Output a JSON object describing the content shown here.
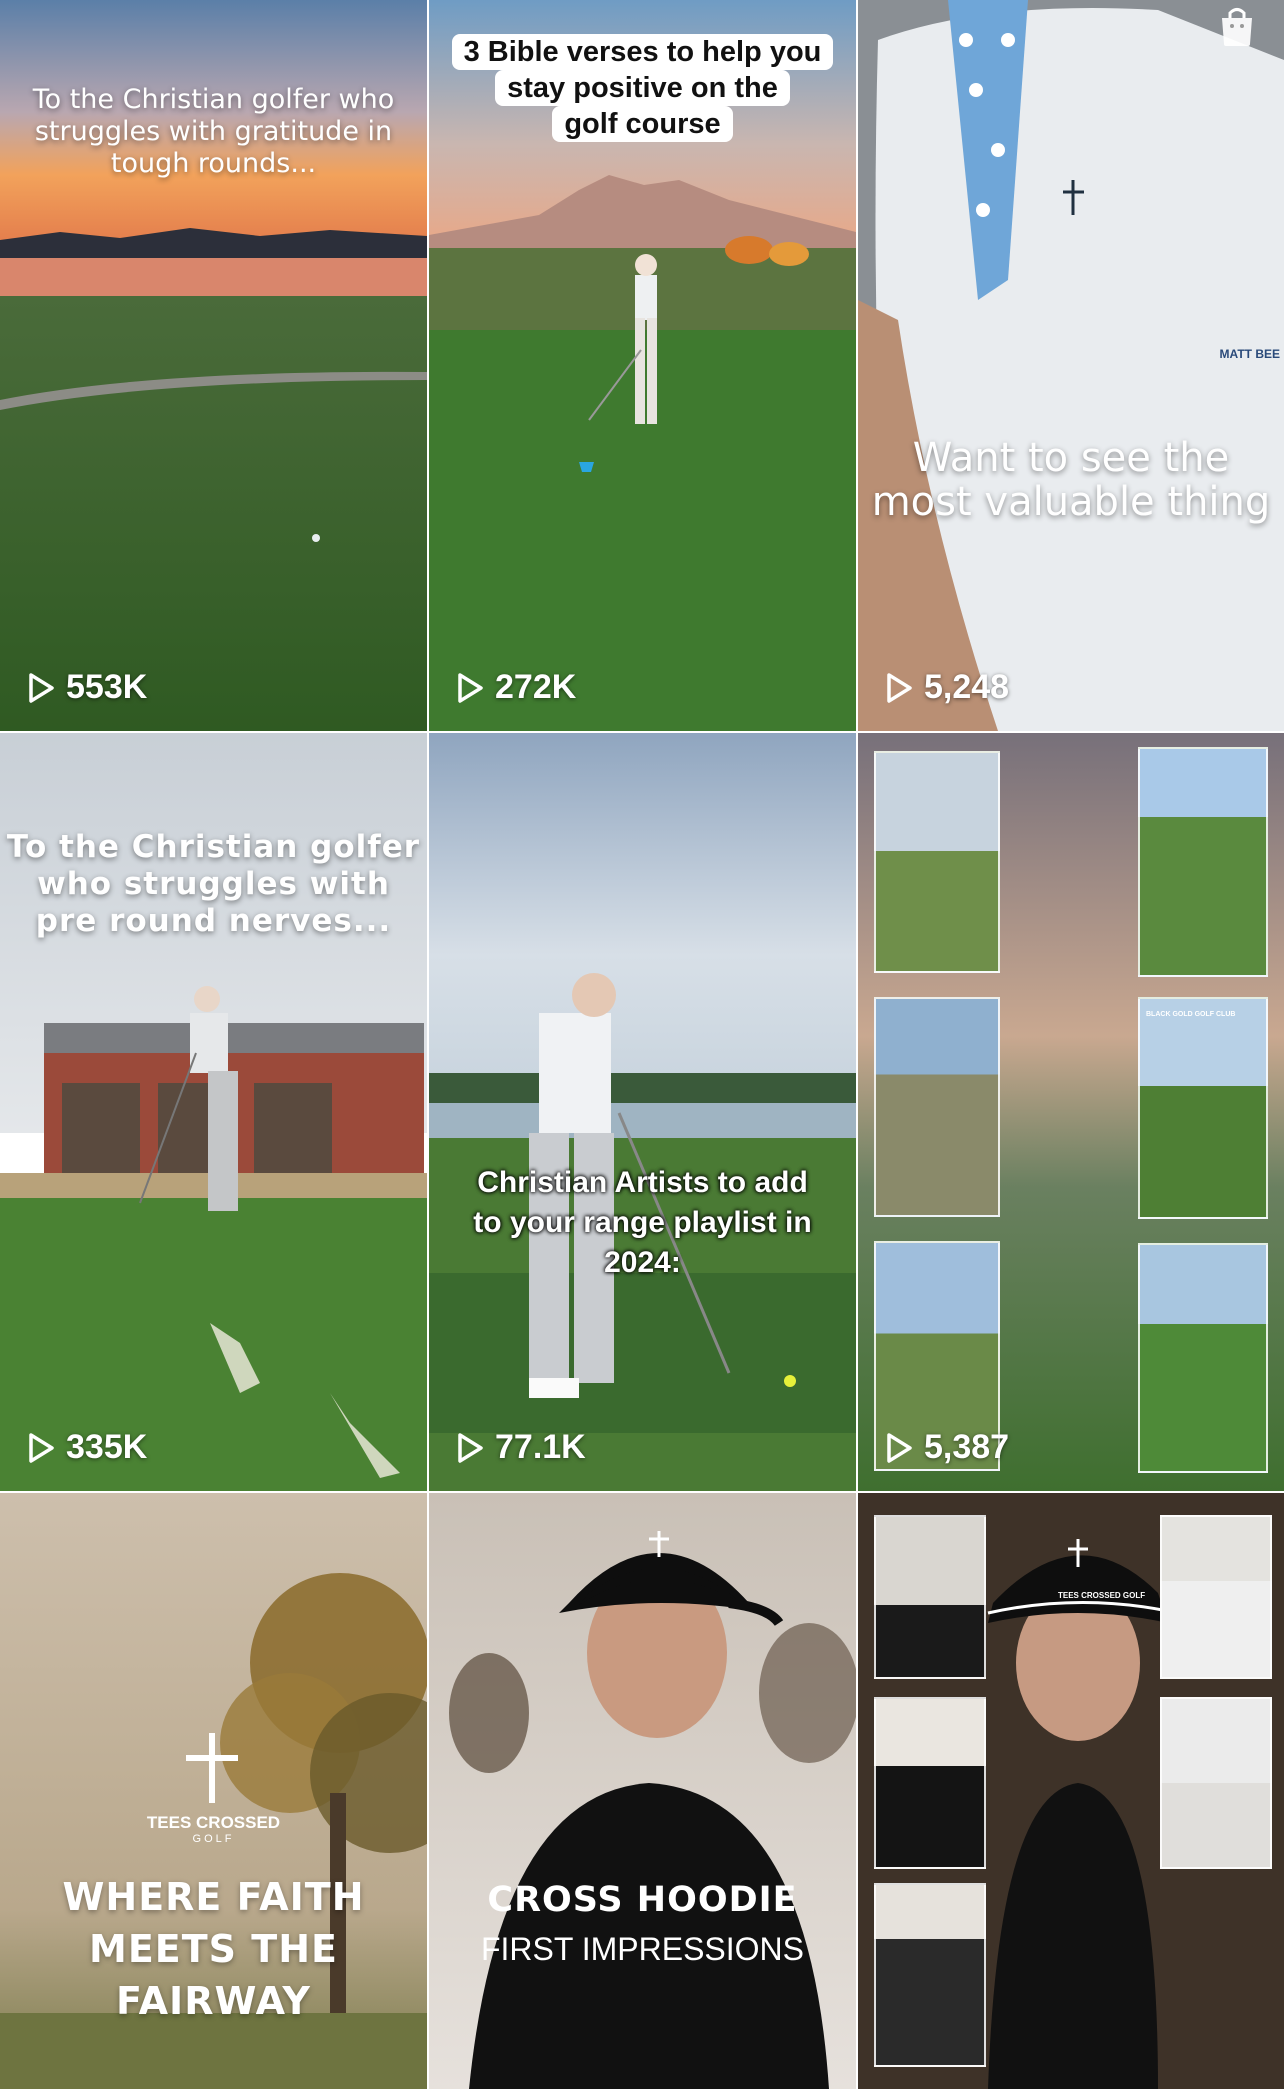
{
  "videos": [
    {
      "caption": "To the Christian golfer who struggles with gratitude in tough rounds...",
      "views": "553K"
    },
    {
      "caption_lines": [
        "3 Bible verses to help you",
        "stay positive on the",
        "golf course"
      ],
      "views": "272K"
    },
    {
      "caption_lines": [
        "Want to see the",
        "most valuable thing"
      ],
      "views": "5,248",
      "shirt_brand": "MATT BEE"
    },
    {
      "caption_lines": [
        "To the Christian golfer",
        "who struggles with",
        "pre round nerves..."
      ],
      "views": "335K"
    },
    {
      "caption_lines": [
        "Christian Artists to add",
        "to your range playlist in",
        "2024:"
      ],
      "views": "77.1K"
    },
    {
      "views": "5,387",
      "photo_label": "BLACK GOLD GOLF CLUB"
    },
    {
      "logo_text": "TEES CROSSED",
      "logo_sub": "GOLF",
      "title_lines": [
        "WHERE FAITH",
        "MEETS THE",
        "FAIRWAY"
      ]
    },
    {
      "title": "CROSS HOODIE",
      "subtitle": "FIRST IMPRESSIONS",
      "hat_text": "TEES CROSSED GOLF"
    },
    {
      "hat_text": "TEES CROSSED GOLF"
    }
  ],
  "icons": {
    "play": "play-icon",
    "shop": "shopping-bag-icon"
  },
  "colors": {
    "text_on_media": "#ffffff",
    "grass": "#3f7a2f"
  }
}
